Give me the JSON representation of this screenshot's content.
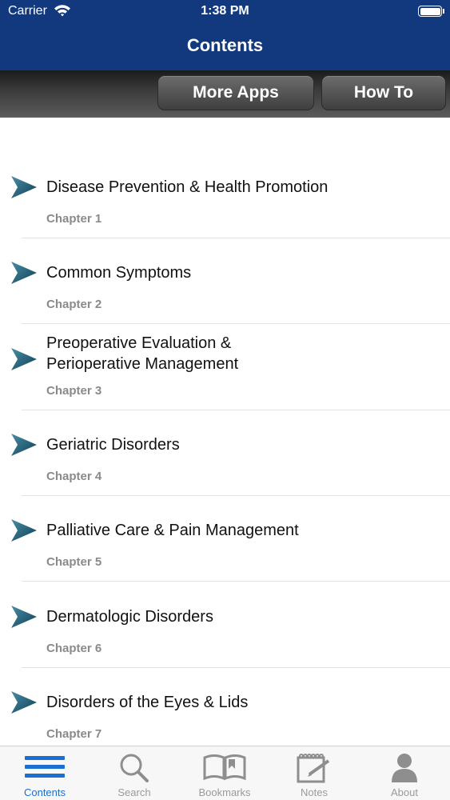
{
  "status_bar": {
    "carrier": "Carrier",
    "time": "1:38 PM",
    "battery_level": 1.0
  },
  "nav": {
    "title": "Contents"
  },
  "toolbar": {
    "more_apps_label": "More Apps",
    "how_to_label": "How To"
  },
  "chapters": [
    {
      "title": "Disease Prevention & Health Promotion",
      "subtitle": "Chapter 1"
    },
    {
      "title": "Common Symptoms",
      "subtitle": "Chapter 2"
    },
    {
      "title": "Preoperative Evaluation & Perioperative Management",
      "subtitle": "Chapter 3"
    },
    {
      "title": "Geriatric Disorders",
      "subtitle": "Chapter 4"
    },
    {
      "title": "Palliative Care & Pain Management",
      "subtitle": "Chapter 5"
    },
    {
      "title": "Dermatologic Disorders",
      "subtitle": "Chapter 6"
    },
    {
      "title": "Disorders of the Eyes & Lids",
      "subtitle": "Chapter 7"
    }
  ],
  "tabs": [
    {
      "label": "Contents",
      "icon": "list-icon",
      "active": true
    },
    {
      "label": "Search",
      "icon": "search-icon",
      "active": false
    },
    {
      "label": "Bookmarks",
      "icon": "book-icon",
      "active": false
    },
    {
      "label": "Notes",
      "icon": "notepad-icon",
      "active": false
    },
    {
      "label": "About",
      "icon": "person-icon",
      "active": false
    }
  ],
  "colors": {
    "header": "#12397e",
    "accent": "#1a6fd1",
    "arrow": "#1b5b73"
  }
}
